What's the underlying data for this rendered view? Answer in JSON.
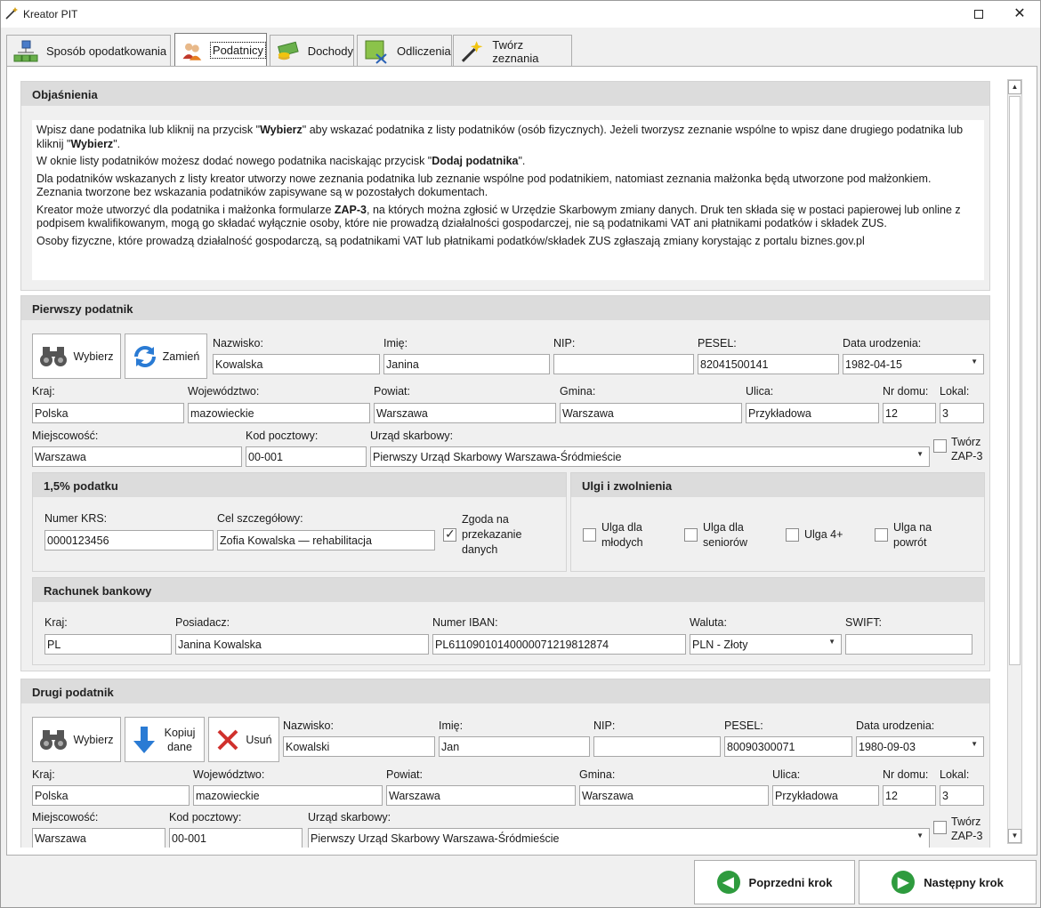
{
  "window": {
    "title": "Kreator PIT"
  },
  "tabs": [
    {
      "label": "Sposób opodatkowania"
    },
    {
      "label": "Podatnicy"
    },
    {
      "label": "Dochody"
    },
    {
      "label": "Odliczenia"
    },
    {
      "label": "Twórz zeznania"
    }
  ],
  "explanations": {
    "header": "Objaśnienia",
    "p1_a": "Wpisz dane podatnika lub kliknij na przycisk \"",
    "p1_b": "Wybierz",
    "p1_c": "\" aby wskazać podatnika z listy podatników (osób fizycznych). Jeżeli tworzysz zeznanie wspólne to wpisz dane drugiego podatnika lub kliknij \"",
    "p1_d": "Wybierz",
    "p1_e": "\".",
    "p2_a": "W oknie listy podatników możesz dodać nowego podatnika naciskając przycisk \"",
    "p2_b": "Dodaj podatnika",
    "p2_c": "\".",
    "p3": "Dla podatników wskazanych z listy kreator utworzy nowe zeznania podatnika lub zeznanie wspólne pod podatnikiem, natomiast zeznania małżonka będą utworzone pod małżonkiem. Zeznania tworzone bez wskazania podatników zapisywane są w pozostałych dokumentach.",
    "p4_a": "Kreator może utworzyć dla podatnika i małżonka formularze ",
    "p4_b": "ZAP-3",
    "p4_c": ", na których można zgłosić w Urzędzie Skarbowym zmiany danych. Druk ten składa się w postaci papierowej lub online z podpisem kwalifikowanym, mogą go składać wyłącznie osoby, które nie prowadzą działalności gospodarczej, nie są podatnikami VAT ani płatnikami podatków i składek ZUS.",
    "p5": "Osoby fizyczne, które prowadzą działalność gospodarczą, są podatnikami VAT lub płatnikami podatków/składek ZUS zgłaszają zmiany korystając z portalu biznes.gov.pl"
  },
  "first": {
    "header": "Pierwszy podatnik",
    "btn_choose": "Wybierz",
    "btn_swap": "Zamień",
    "labels": {
      "surname": "Nazwisko:",
      "name": "Imię:",
      "nip": "NIP:",
      "pesel": "PESEL:",
      "dob": "Data urodzenia:",
      "country": "Kraj:",
      "voiv": "Województwo:",
      "county": "Powiat:",
      "commune": "Gmina:",
      "street": "Ulica:",
      "house": "Nr domu:",
      "flat": "Lokal:",
      "city": "Miejscowość:",
      "zip": "Kod pocztowy:",
      "office": "Urząd skarbowy:",
      "zap3": "Twórz ZAP-3"
    },
    "values": {
      "surname": "Kowalska",
      "name": "Janina",
      "nip": "",
      "pesel": "82041500141",
      "dob": "1982-04-15",
      "country": "Polska",
      "voiv": "mazowieckie",
      "county": "Warszawa",
      "commune": "Warszawa",
      "street": "Przykładowa",
      "house": "12",
      "flat": "3",
      "city": "Warszawa",
      "zip": "00-001",
      "office": "Pierwszy Urząd Skarbowy Warszawa-Śródmieście"
    },
    "opp": {
      "header": "1,5% podatku",
      "krs_label": "Numer KRS:",
      "goal_label": "Cel szczegółowy:",
      "krs": "0000123456",
      "goal": "Zofia Kowalska — rehabilitacja",
      "consent": "Zgoda na przekazanie danych"
    },
    "reliefs": {
      "header": "Ulgi i zwolnienia",
      "young": "Ulga dla młodych",
      "seniors": "Ulga dla seniorów",
      "u4": "Ulga 4+",
      "back": "Ulga na powrót"
    },
    "bank": {
      "header": "Rachunek bankowy",
      "country_label": "Kraj:",
      "owner_label": "Posiadacz:",
      "iban_label": "Numer IBAN:",
      "currency_label": "Waluta:",
      "swift_label": "SWIFT:",
      "country": "PL",
      "owner": "Janina Kowalska",
      "iban": "PL61109010140000071219812874",
      "currency": "PLN - Złoty",
      "swift": ""
    }
  },
  "second": {
    "header": "Drugi podatnik",
    "btn_choose": "Wybierz",
    "btn_copy": "Kopiuj dane",
    "btn_remove": "Usuń",
    "values": {
      "surname": "Kowalski",
      "name": "Jan",
      "nip": "",
      "pesel": "80090300071",
      "dob": "1980-09-03",
      "country": "Polska",
      "voiv": "mazowieckie",
      "county": "Warszawa",
      "commune": "Warszawa",
      "street": "Przykładowa",
      "house": "12",
      "flat": "3",
      "city": "Warszawa",
      "zip": "00-001",
      "office": "Pierwszy Urząd Skarbowy Warszawa-Śródmieście"
    }
  },
  "footer": {
    "prev": "Poprzedni krok",
    "next": "Następny krok"
  }
}
